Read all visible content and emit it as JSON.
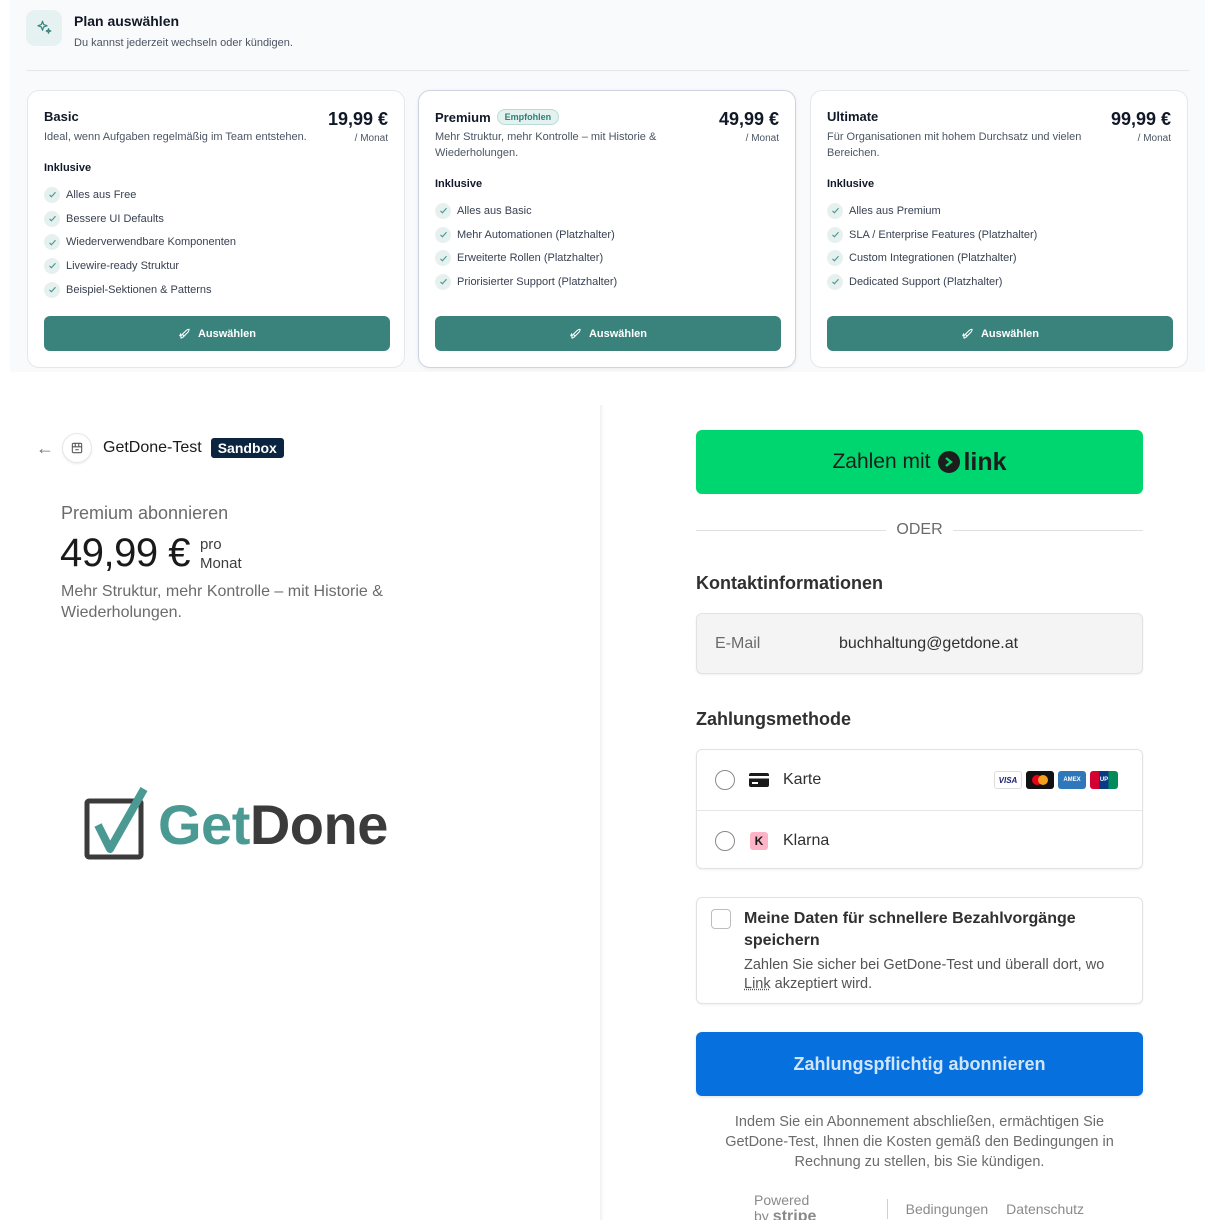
{
  "plans_panel": {
    "title": "Plan auswählen",
    "subtitle": "Du kannst jederzeit wechseln oder kündigen.",
    "inclusive_label": "Inklusive",
    "plans": [
      {
        "name": "Basic",
        "badge": "",
        "price": "19,99 €",
        "period": "/ Monat",
        "description": "Ideal, wenn Aufgaben regelmäßig im Team entstehen.",
        "features": [
          "Alles aus Free",
          "Bessere UI Defaults",
          "Wiederverwendbare Komponenten",
          "Livewire-ready Struktur",
          "Beispiel-Sektionen & Patterns"
        ],
        "button": "Auswählen"
      },
      {
        "name": "Premium",
        "badge": "Empfohlen",
        "price": "49,99 €",
        "period": "/ Monat",
        "description": "Mehr Struktur, mehr Kontrolle – mit Historie & Wiederholungen.",
        "features": [
          "Alles aus Basic",
          "Mehr Automationen (Platzhalter)",
          "Erweiterte Rollen (Platzhalter)",
          "Priorisierter Support (Platzhalter)"
        ],
        "button": "Auswählen"
      },
      {
        "name": "Ultimate",
        "badge": "",
        "price": "99,99 €",
        "period": "/ Monat",
        "description": "Für Organisationen mit hohem Durchsatz und vielen Bereichen.",
        "features": [
          "Alles aus Premium",
          "SLA / Enterprise Features (Platzhalter)",
          "Custom Integrationen (Platzhalter)",
          "Dedicated Support (Platzhalter)"
        ],
        "button": "Auswählen"
      }
    ]
  },
  "checkout": {
    "merchant": "GetDone-Test",
    "sandbox_badge": "Sandbox",
    "subscribe_title": "Premium abonnieren",
    "price": "49,99 €",
    "per": "pro",
    "period": "Monat",
    "description": "Mehr Struktur, mehr Kontrolle – mit Historie & Wiederholungen.",
    "logo": {
      "part1": "Get",
      "part2": "Done"
    },
    "link_button": {
      "text": "Zahlen mit",
      "brand": "link"
    },
    "or_text": "ODER",
    "contact_heading": "Kontaktinformationen",
    "email_label": "E-Mail",
    "email_value": "buchhaltung@getdone.at",
    "payment_heading": "Zahlungsmethode",
    "payment_methods": [
      {
        "label": "Karte",
        "icon": "card-icon"
      },
      {
        "label": "Klarna",
        "icon": "klarna-icon"
      }
    ],
    "card_brands": [
      "VISA",
      "Mastercard",
      "AMEX",
      "UnionPay"
    ],
    "save_title": "Meine Daten für schnellere Bezahlvorgänge speichern",
    "save_text_before": "Zahlen Sie sicher bei GetDone-Test und überall dort, wo ",
    "save_text_link": "Link",
    "save_text_after": " akzeptiert wird.",
    "subscribe_button": "Zahlungspflichtig abonnieren",
    "legal_text": "Indem Sie ein Abonnement abschließen, ermächtigen Sie GetDone-Test, Ihnen die Kosten gemäß den Bedingungen in Rechnung zu stellen, bis Sie kündigen.",
    "powered_by": "Powered by",
    "powered_brand": "stripe",
    "footer_links": [
      "Bedingungen",
      "Datenschutz"
    ]
  },
  "colors": {
    "accent_teal": "#3a837c",
    "link_green": "#00d66f",
    "stripe_blue": "#0570de",
    "sandbox_navy": "#0b2540"
  }
}
